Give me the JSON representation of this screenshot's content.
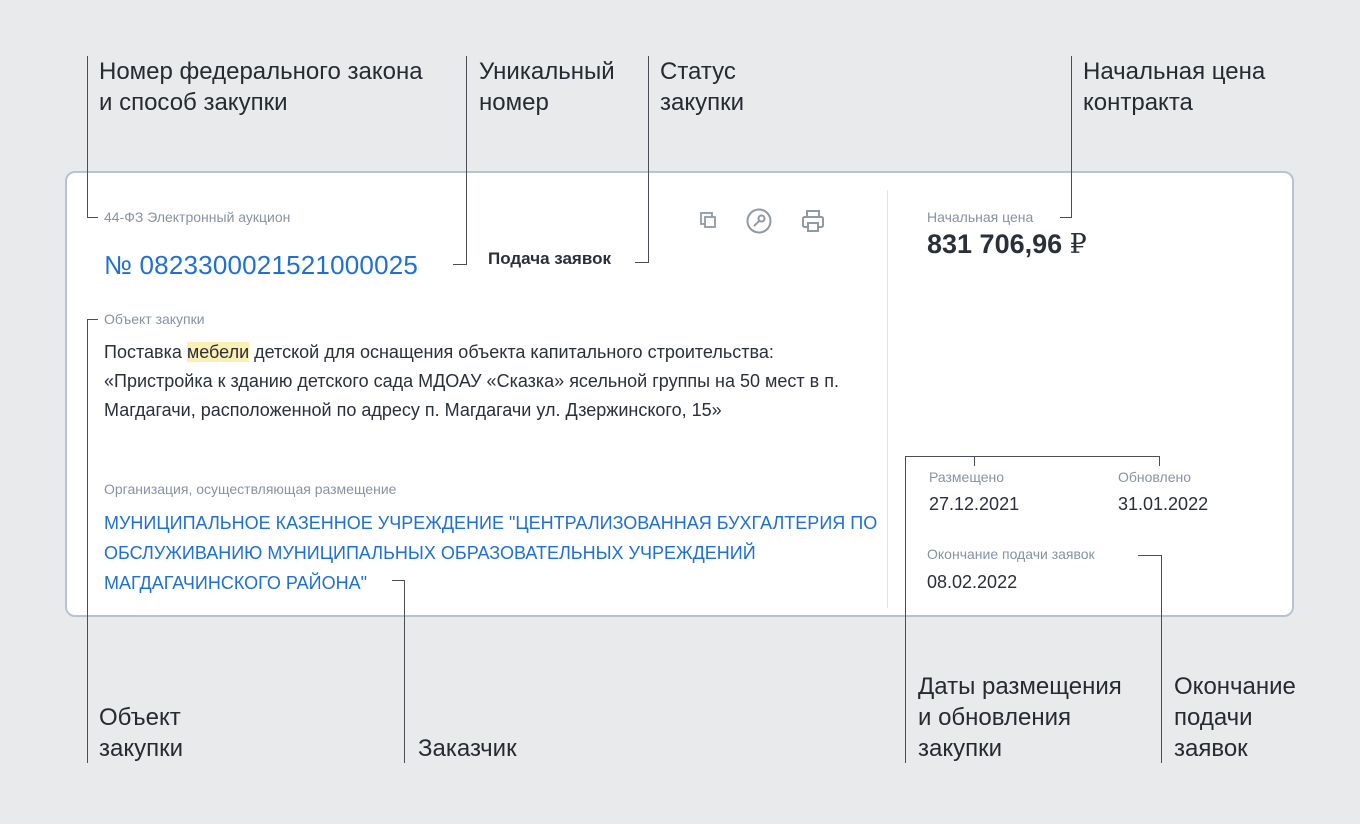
{
  "callouts": {
    "law_method": [
      "Номер федерального закона",
      "и способ закупки"
    ],
    "unique_number": [
      "Уникальный",
      "номер"
    ],
    "status": [
      "Статус",
      "закупки"
    ],
    "initial_price": [
      "Начальная цена",
      "контракта"
    ],
    "object": [
      "Объект",
      "закупки"
    ],
    "customer": "Заказчик",
    "dates": [
      "Даты размещения",
      "и обновления",
      "закупки"
    ],
    "deadline": [
      "Окончание",
      "подачи",
      "заявок"
    ]
  },
  "card": {
    "law_method": "44-ФЗ Электронный аукцион",
    "number": "№ 0823300021521000025",
    "status": "Подача заявок",
    "icons": [
      "copy-icon",
      "key-icon",
      "print-icon"
    ],
    "object_label": "Объект закупки",
    "object_text_before": "Поставка ",
    "object_text_highlight": "мебели",
    "object_text_after": " детской для оснащения объекта капитального строительства: «Пристройка к зданию детского сада МДОАУ «Сказка» ясельной группы на 50 мест в п. Магдагачи, расположенной по адресу п. Магдагачи ул. Дзержинского, 15»",
    "org_label": "Организация, осуществляющая размещение",
    "org_name": "МУНИЦИПАЛЬНОЕ КАЗЕННОЕ УЧРЕЖДЕНИЕ \"ЦЕНТРАЛИЗОВАННАЯ БУХГАЛТЕРИЯ ПО ОБСЛУЖИВАНИЮ МУНИЦИПАЛЬНЫХ ОБРАЗОВАТЕЛЬНЫХ УЧРЕЖДЕНИЙ МАГДАГАЧИНСКОГО РАЙОНА\"",
    "price_label": "Начальная цена",
    "price_value": "831 706,96",
    "price_currency": "₽",
    "posted_label": "Размещено",
    "posted_value": "27.12.2021",
    "updated_label": "Обновлено",
    "updated_value": "31.01.2022",
    "deadline_label": "Окончание подачи заявок",
    "deadline_value": "08.02.2022"
  },
  "colors": {
    "accent": "#1e6fd9",
    "highlight": "#fcefb4",
    "background": "#e9eaec"
  }
}
